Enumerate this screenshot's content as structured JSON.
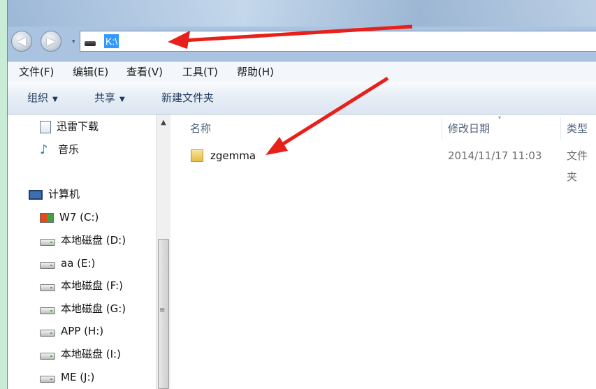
{
  "address": {
    "path": "K:\\"
  },
  "nav_buttons": {
    "back": "◀",
    "forward": "▶",
    "dropdown": "▾"
  },
  "menu": [
    "文件(F)",
    "编辑(E)",
    "查看(V)",
    "工具(T)",
    "帮助(H)"
  ],
  "toolbar": {
    "organize": "组织",
    "share": "共享",
    "new_folder": "新建文件夹",
    "arrow": "▼"
  },
  "nav_pane": [
    {
      "label": "迅雷下载",
      "icon": "download-folder-icon"
    },
    {
      "label": "音乐",
      "icon": "music-icon"
    },
    {
      "label": "计算机",
      "icon": "computer-icon"
    },
    {
      "label": "W7 (C:)",
      "icon": "system-drive-icon"
    },
    {
      "label": "本地磁盘 (D:)",
      "icon": "drive-icon"
    },
    {
      "label": "aa (E:)",
      "icon": "drive-icon"
    },
    {
      "label": "本地磁盘 (F:)",
      "icon": "drive-icon"
    },
    {
      "label": "本地磁盘 (G:)",
      "icon": "drive-icon"
    },
    {
      "label": "APP (H:)",
      "icon": "drive-icon"
    },
    {
      "label": "本地磁盘 (I:)",
      "icon": "drive-icon"
    },
    {
      "label": "ME (J:)",
      "icon": "drive-icon"
    }
  ],
  "columns": {
    "name": "名称",
    "date": "修改日期",
    "type": "类型"
  },
  "files": [
    {
      "name": "zgemma",
      "date": "2014/11/17 11:03",
      "type": "文件夹",
      "icon": "folder-icon"
    }
  ],
  "scrollbar": {
    "up_arrow": "▲",
    "grip": "≡"
  },
  "annotation_color": "#e8201c"
}
